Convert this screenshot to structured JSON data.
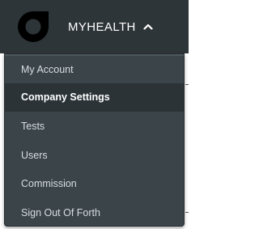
{
  "header": {
    "brand_label": "MYHEALTH",
    "logo_icon": "app-logo-icon",
    "toggle_icon": "chevron-up-icon"
  },
  "menu": {
    "items": [
      {
        "label": "My Account",
        "active": false
      },
      {
        "label": "Company Settings",
        "active": true
      },
      {
        "label": "Tests",
        "active": false
      },
      {
        "label": "Users",
        "active": false
      },
      {
        "label": "Commission",
        "active": false
      },
      {
        "label": "Sign Out Of Forth",
        "active": false
      }
    ]
  },
  "colors": {
    "header_bg": "#2e3538",
    "menu_bg": "#3a4449",
    "menu_active_bg": "#2b3337",
    "text": "#ffffff"
  }
}
